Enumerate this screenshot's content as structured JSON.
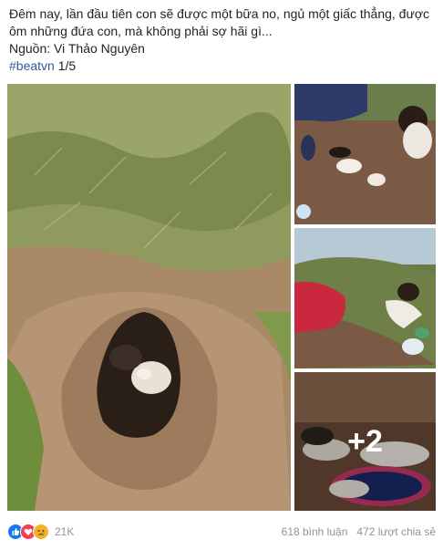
{
  "post": {
    "line1": "Đêm nay, lần đầu tiên con sẽ được một bữa no, ngủ một giấc thẳng, được",
    "line2": "ôm những đứa con, mà không phải sợ hãi gì...",
    "source": "Nguồn: Vi Thảo Nguyên",
    "hashtag": "#beatvn",
    "page_counter": "1/5"
  },
  "photos": {
    "more_count": "+2"
  },
  "footer": {
    "reaction_count": "21K",
    "comments": "618 bình luận",
    "shares": "472 lượt chia sẻ"
  },
  "colors": {
    "link": "#385898",
    "muted": "#90949c",
    "like": "#1877f2",
    "love": "#f33e58",
    "sad": "#f7b125"
  },
  "icons": [
    "like-reaction-icon",
    "love-reaction-icon",
    "sad-reaction-icon"
  ]
}
